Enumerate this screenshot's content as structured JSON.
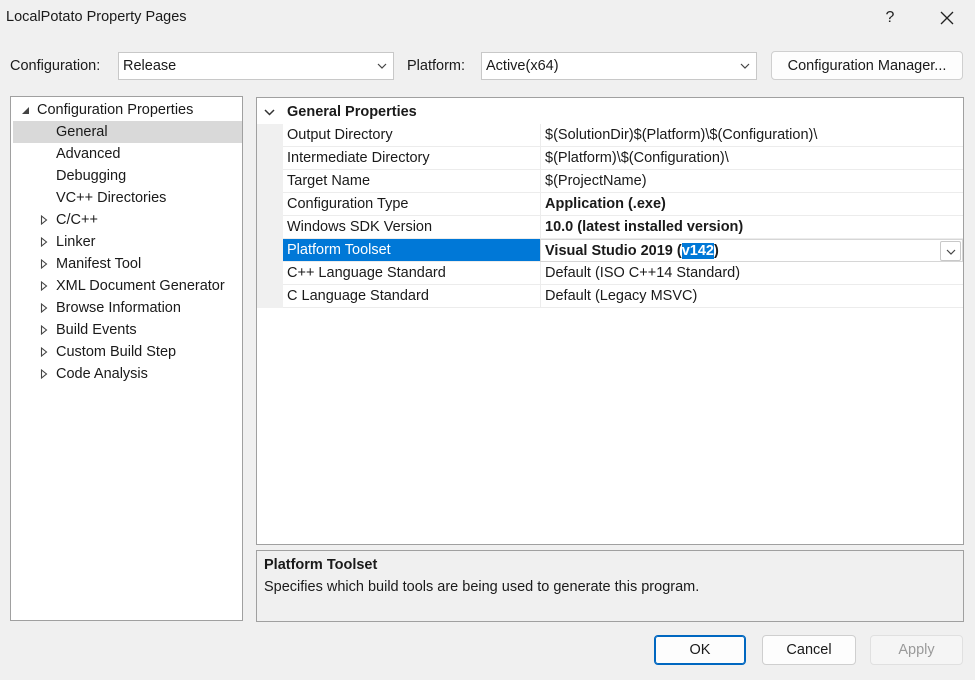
{
  "window": {
    "title": "LocalPotato Property Pages",
    "help_label": "?",
    "close_label": "✕"
  },
  "config": {
    "configuration_label": "Configuration:",
    "configuration_value": "Release",
    "platform_label": "Platform:",
    "platform_value": "Active(x64)",
    "manager_button": "Configuration Manager..."
  },
  "tree": {
    "root": "Configuration Properties",
    "items": [
      {
        "label": "General",
        "expandable": false,
        "selected": true
      },
      {
        "label": "Advanced",
        "expandable": false
      },
      {
        "label": "Debugging",
        "expandable": false
      },
      {
        "label": "VC++ Directories",
        "expandable": false
      },
      {
        "label": "C/C++",
        "expandable": true
      },
      {
        "label": "Linker",
        "expandable": true
      },
      {
        "label": "Manifest Tool",
        "expandable": true
      },
      {
        "label": "XML Document Generator",
        "expandable": true
      },
      {
        "label": "Browse Information",
        "expandable": true
      },
      {
        "label": "Build Events",
        "expandable": true
      },
      {
        "label": "Custom Build Step",
        "expandable": true
      },
      {
        "label": "Code Analysis",
        "expandable": true
      }
    ]
  },
  "grid": {
    "section": "General Properties",
    "rows": [
      {
        "name": "Output Directory",
        "value": "$(SolutionDir)$(Platform)\\$(Configuration)\\"
      },
      {
        "name": "Intermediate Directory",
        "value": "$(Platform)\\$(Configuration)\\"
      },
      {
        "name": "Target Name",
        "value": "$(ProjectName)"
      },
      {
        "name": "Configuration Type",
        "value": "Application (.exe)"
      },
      {
        "name": "Windows SDK Version",
        "value": "10.0 (latest installed version)"
      },
      {
        "name": "Platform Toolset",
        "value_prefix": "Visual Studio 2019 (",
        "value_highlight": "v142",
        "value_suffix": ")"
      },
      {
        "name": "C++ Language Standard",
        "value": "Default (ISO C++14 Standard)"
      },
      {
        "name": "C Language Standard",
        "value": "Default (Legacy MSVC)"
      }
    ]
  },
  "description": {
    "title": "Platform Toolset",
    "text": "Specifies which build tools are being used to generate this program."
  },
  "buttons": {
    "ok": "OK",
    "cancel": "Cancel",
    "apply": "Apply"
  },
  "colors": {
    "selection": "#0078d7",
    "tree_selected": "#d9d9d9"
  }
}
